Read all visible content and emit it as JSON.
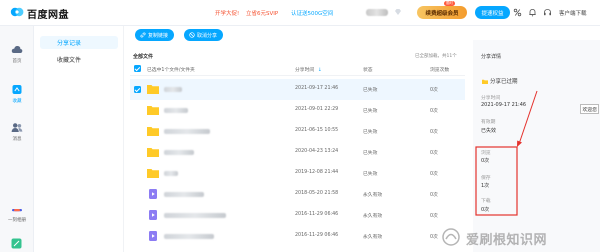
{
  "header": {
    "brand": "百度网盘",
    "promo_start": "开学大促!",
    "promo_vip": "立省6元SVIP",
    "promo_certify": "认证送500G空间",
    "gold_button": "续费超级会员",
    "gold_badge": "限时",
    "blue_button": "提速权益",
    "client_download": "客户端下载"
  },
  "rail": {
    "items": [
      {
        "label": "首页"
      },
      {
        "label": "收藏"
      },
      {
        "label": "消息"
      },
      {
        "label": "一刻相册"
      }
    ]
  },
  "subnav": {
    "items": [
      {
        "label": "分享记录",
        "active": true
      },
      {
        "label": "收藏文件",
        "active": false
      }
    ]
  },
  "toolbar": {
    "copy_link": "复制链接",
    "cancel_share": "取消分享"
  },
  "list": {
    "section_title": "全部文件",
    "loaded_count": "已全部加载，共11个",
    "columns": {
      "selected": "已选中1个文件/文件夹",
      "share_time": "分享时间",
      "status": "状态",
      "views": "浏览次数"
    },
    "rows": [
      {
        "type": "folder",
        "time": "2021-09-17 21:46",
        "status": "已失效",
        "views": "0次",
        "selected": true
      },
      {
        "type": "folder",
        "time": "2021-09-01 22:29",
        "status": "已失效",
        "views": "0次",
        "selected": false
      },
      {
        "type": "folder",
        "time": "2021-06-15 10:55",
        "status": "已失效",
        "views": "0次",
        "selected": false
      },
      {
        "type": "folder",
        "time": "2020-04-23 13:24",
        "status": "已失效",
        "views": "0次",
        "selected": false
      },
      {
        "type": "folder",
        "time": "2019-12-08 21:44",
        "status": "已失效",
        "views": "0次",
        "selected": false
      },
      {
        "type": "video",
        "time": "2018-05-20 21:58",
        "status": "永久有效",
        "views": "0次",
        "selected": false
      },
      {
        "type": "video",
        "time": "2016-11-29 06:46",
        "status": "永久有效",
        "views": "0次",
        "selected": false
      },
      {
        "type": "video",
        "time": "2016-11-29 06:46",
        "status": "永久有效",
        "views": "0次",
        "selected": false
      }
    ]
  },
  "detail": {
    "title": "分享详情",
    "expired": "分享已过期",
    "share_time_label": "分享时间",
    "share_time": "2021-09-17 21:46",
    "validity_label": "有效期",
    "validity": "已失效",
    "views_label": "浏览",
    "views": "0次",
    "saves_label": "保存",
    "saves": "1次",
    "downloads_label": "下载",
    "downloads": "0次",
    "tooltip": "欢迎您"
  },
  "watermark": "爱刷根知识网",
  "colors": {
    "accent": "#06a7ff",
    "promo_red": "#f5502f",
    "annotation_red": "#e5322d",
    "folder": "#ffca28",
    "video": "#8c7cf3"
  }
}
